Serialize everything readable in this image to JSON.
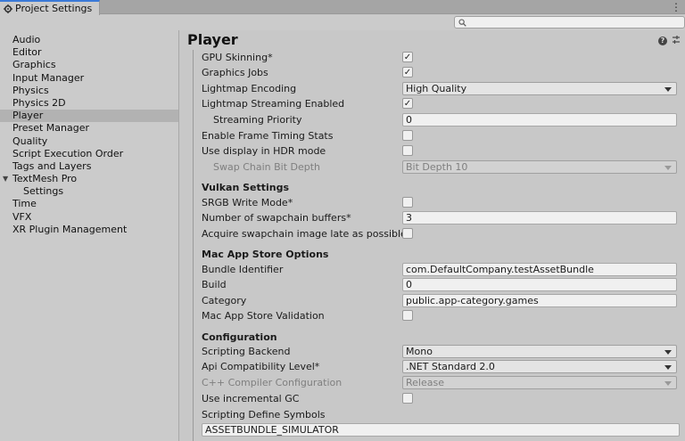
{
  "tab": {
    "title": "Project Settings",
    "icon": "gear-icon"
  },
  "search": {
    "placeholder": ""
  },
  "sidebar": {
    "items": [
      {
        "label": "Audio"
      },
      {
        "label": "Editor"
      },
      {
        "label": "Graphics"
      },
      {
        "label": "Input Manager"
      },
      {
        "label": "Physics"
      },
      {
        "label": "Physics 2D"
      },
      {
        "label": "Player",
        "selected": true
      },
      {
        "label": "Preset Manager"
      },
      {
        "label": "Quality"
      },
      {
        "label": "Script Execution Order"
      },
      {
        "label": "Tags and Layers"
      },
      {
        "label": "TextMesh Pro",
        "expanded": true
      },
      {
        "label": "Settings",
        "child": true
      },
      {
        "label": "Time"
      },
      {
        "label": "VFX"
      },
      {
        "label": "XR Plugin Management"
      }
    ]
  },
  "main": {
    "title": "Player",
    "rows": {
      "gpu_skinning": {
        "label": "GPU Skinning*",
        "checked": true
      },
      "graphics_jobs": {
        "label": "Graphics Jobs",
        "checked": true
      },
      "lightmap_encoding": {
        "label": "Lightmap Encoding",
        "value": "High Quality"
      },
      "lightmap_streaming": {
        "label": "Lightmap Streaming Enabled",
        "checked": true
      },
      "streaming_priority": {
        "label": "Streaming Priority",
        "value": "0"
      },
      "frame_timing": {
        "label": "Enable Frame Timing Stats",
        "checked": false
      },
      "hdr_display": {
        "label": "Use display in HDR mode",
        "checked": false
      },
      "swap_chain_depth": {
        "label": "Swap Chain Bit Depth",
        "value": "Bit Depth 10"
      },
      "srgb_write": {
        "label": "SRGB Write Mode*",
        "checked": false
      },
      "swapchain_buffers": {
        "label": "Number of swapchain buffers*",
        "value": "3"
      },
      "acquire_late": {
        "label": "Acquire swapchain image late as possible*",
        "checked": false
      },
      "bundle_id": {
        "label": "Bundle Identifier",
        "value": "com.DefaultCompany.testAssetBundle"
      },
      "build": {
        "label": "Build",
        "value": "0"
      },
      "category": {
        "label": "Category",
        "value": "public.app-category.games"
      },
      "mas_validation": {
        "label": "Mac App Store Validation",
        "checked": false
      },
      "scripting_backend": {
        "label": "Scripting Backend",
        "value": "Mono"
      },
      "api_level": {
        "label": "Api Compatibility Level*",
        "value": ".NET Standard 2.0"
      },
      "cpp_config": {
        "label": "C++ Compiler Configuration",
        "value": "Release"
      },
      "incremental_gc": {
        "label": "Use incremental GC",
        "checked": false
      },
      "define_symbols": {
        "label": "Scripting Define Symbols",
        "value": "ASSETBUNDLE_SIMULATOR"
      }
    },
    "sections": {
      "vulkan": "Vulkan Settings",
      "mac_app_store": "Mac App Store Options",
      "configuration": "Configuration"
    }
  }
}
